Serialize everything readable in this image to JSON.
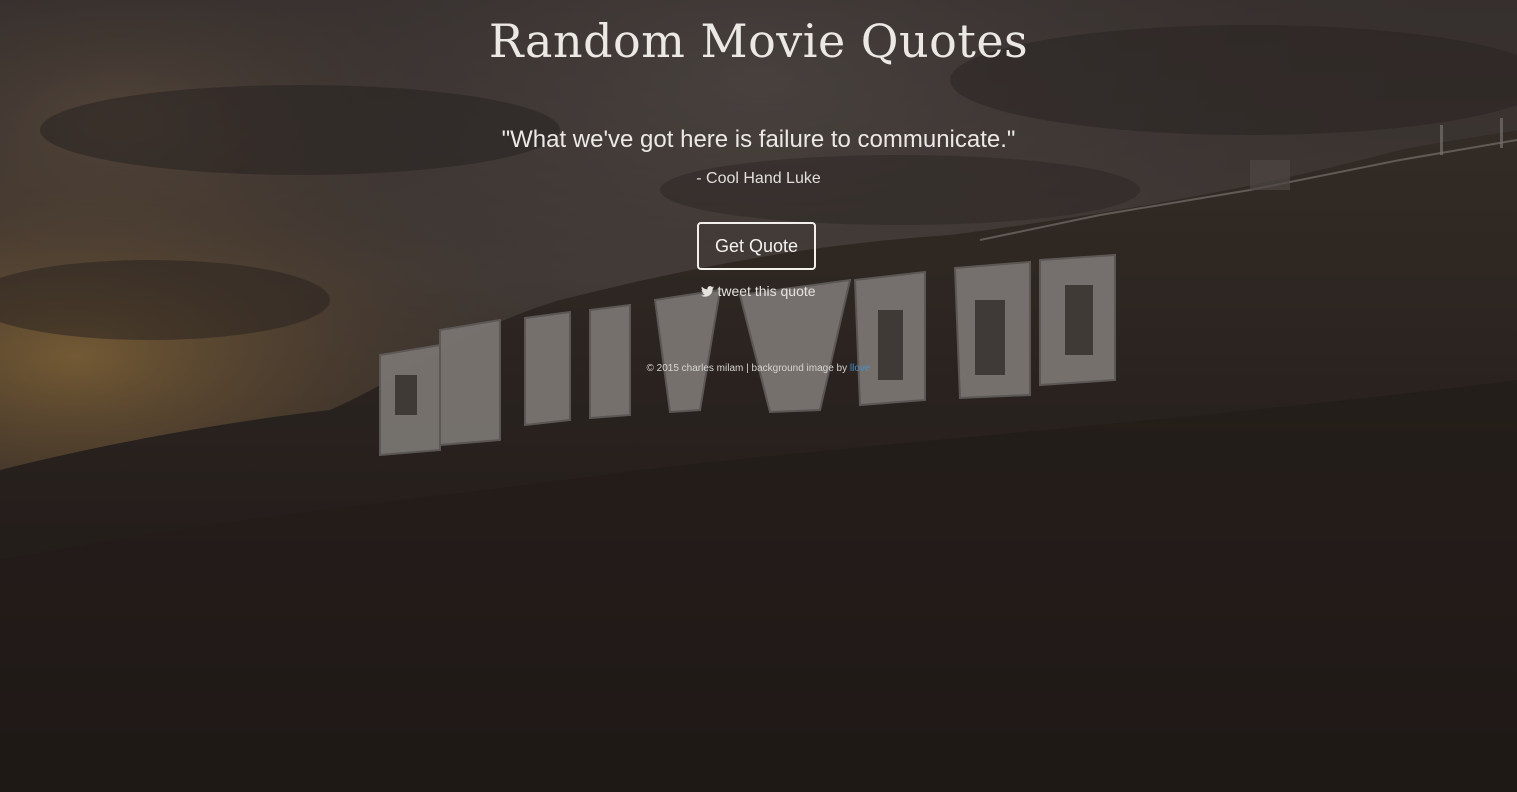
{
  "page": {
    "title": "Random Movie Quotes"
  },
  "quote": {
    "text": "\"What we've got here is failure to communicate.\"",
    "author": "- Cool Hand Luke"
  },
  "actions": {
    "get_quote_label": "Get Quote",
    "tweet_label": "tweet this quote",
    "tweet_icon": "twitter-bird-icon"
  },
  "footer": {
    "credit_text": "© 2015 charles milam | background image by ",
    "credit_link": "llove"
  },
  "colors": {
    "text": "#ece9e5",
    "link": "#4a8ec7",
    "button_border": "#f2f0ed"
  },
  "background": {
    "description_icon": "hollywood-sign-background-image"
  }
}
